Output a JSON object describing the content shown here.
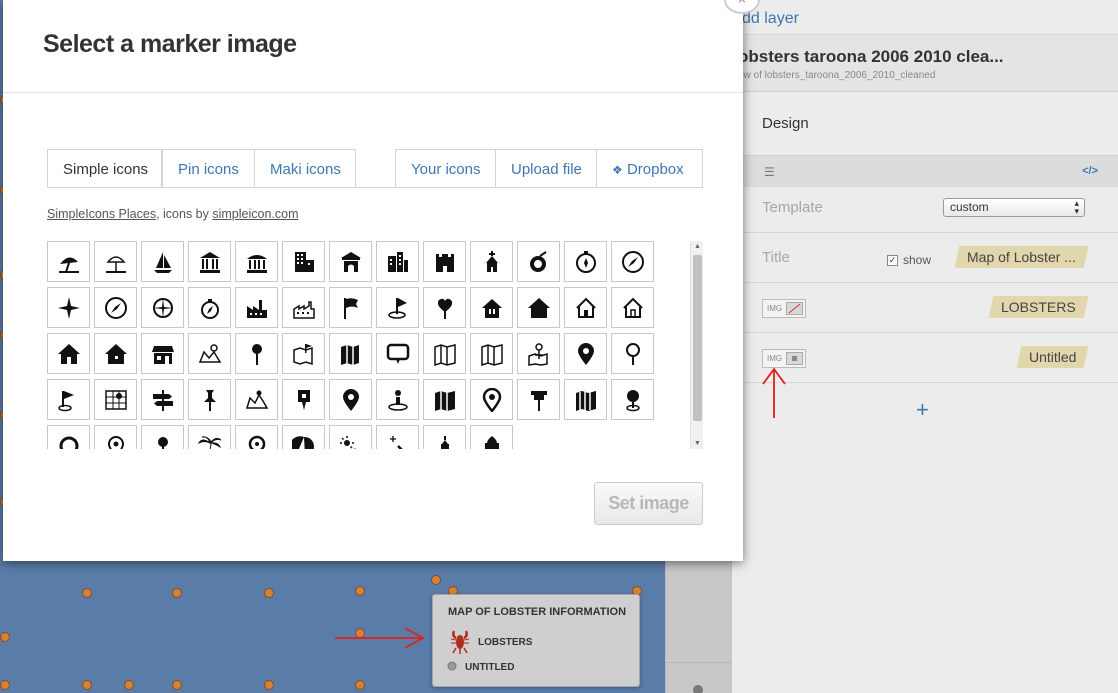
{
  "modal": {
    "title": "Select a marker image",
    "close_label": "×",
    "tabs": [
      "Simple icons",
      "Pin icons",
      "Maki icons"
    ],
    "source_tabs": [
      "Your icons",
      "Upload file",
      "Dropbox"
    ],
    "credit_link_1": "SimpleIcons Places",
    "credit_text": ", icons by ",
    "credit_link_2": "simpleicon.com",
    "set_image_label": "Set image"
  },
  "icons": [
    "beach-umbrella-icon",
    "beach-umbrella-2-icon",
    "sailboat-icon",
    "museum-icon",
    "museum-2-icon",
    "office-building-icon",
    "temple-icon",
    "city-buildings-icon",
    "castle-icon",
    "church-icon",
    "cocktail-icon",
    "compass-dial-icon",
    "compass-icon",
    "compass-rose-icon",
    "compass-circle-icon",
    "compass-star-icon",
    "compass-small-icon",
    "factory-icon",
    "factory-2-icon",
    "flag-icon",
    "golf-flag-icon",
    "pin-heart-icon",
    "house-door-icon",
    "house-icon",
    "house-outline-icon",
    "house-outline-2-icon",
    "house-solid-icon",
    "house-solid-2-icon",
    "shop-icon",
    "map-route-icon",
    "map-pin-icon",
    "map-folded-flag-icon",
    "map-folded-solid-icon",
    "speech-pin-icon",
    "map-folded-icon",
    "map-folded-2-icon",
    "map-anchor-icon",
    "location-pin-icon",
    "location-pin-2-icon",
    "golf-flag-2-icon",
    "map-grid-pin-icon",
    "signpost-icon",
    "pushpin-icon",
    "map-mountain-icon",
    "map-marker-square-icon",
    "map-marker-icon",
    "person-pin-icon",
    "map-book-icon",
    "map-marker-2-icon",
    "pushpin-2-icon",
    "map-book-2-icon",
    "pin-disc-icon",
    "pin-ring-icon",
    "pin-small-icon",
    "pin-stick-icon",
    "palm-tree-icon",
    "pin-round-icon",
    "sunset-icon",
    "sun-wand-icon",
    "sparkle-wand-icon",
    "tower-icon",
    "mosque-icon"
  ],
  "panel": {
    "add_layer": "dd layer",
    "layer_title": "obsters taroona 2006 2010 clea...",
    "layer_subtitle": "ew of lobsters_taroona_2006_2010_cleaned",
    "design_tab": "Design",
    "code_icon_label": "</>",
    "template_label": "Template",
    "template_value": "custom",
    "title_label": "Title",
    "show_label": "show",
    "title_value": "Map of Lobster ...",
    "layer1_name": "LOBSTERS",
    "layer2_name": "Untitled",
    "img_chip_label": "IMG",
    "add_plus": "+"
  },
  "legend": {
    "title": "MAP OF LOBSTER INFORMATION",
    "item1": "LOBSTERS",
    "item2": "UNTITLED"
  },
  "colors": {
    "accent": "#3b77b3",
    "map_bg": "#5a7ca8",
    "dot": "#d4813d",
    "tag_bg": "#e2d6ad",
    "arrow": "#e0201e"
  }
}
